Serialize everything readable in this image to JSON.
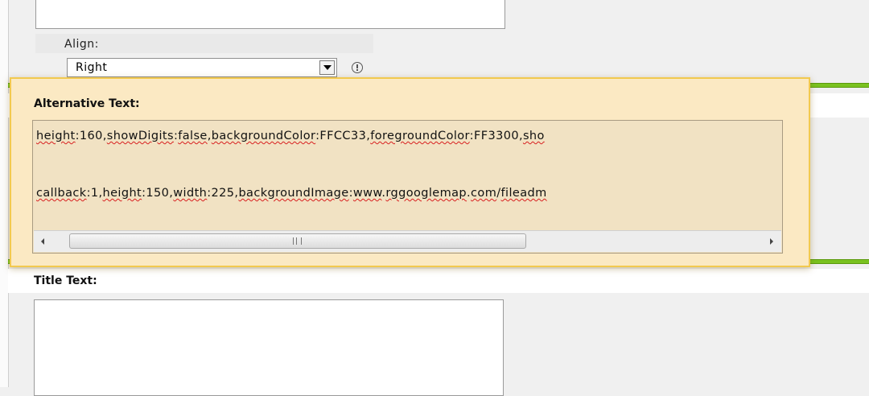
{
  "align": {
    "label": "Align:",
    "selected": "Right"
  },
  "alt_text": {
    "label": "Alternative Text:",
    "line1_parts": [
      {
        "t": "height",
        "err": true
      },
      {
        "t": ":160,",
        "err": false
      },
      {
        "t": "showDigits",
        "err": true
      },
      {
        "t": ":",
        "err": false
      },
      {
        "t": "false",
        "err": true
      },
      {
        "t": ",",
        "err": false
      },
      {
        "t": "backgroundColor",
        "err": true
      },
      {
        "t": ":FFCC33,",
        "err": false
      },
      {
        "t": "foregroundColor",
        "err": true
      },
      {
        "t": ":FF3300,",
        "err": false
      },
      {
        "t": "sho",
        "err": true
      }
    ],
    "line2_parts": [
      {
        "t": "callback",
        "err": true
      },
      {
        "t": ":1,",
        "err": false
      },
      {
        "t": "height",
        "err": true
      },
      {
        "t": ":150,",
        "err": false
      },
      {
        "t": "width",
        "err": true
      },
      {
        "t": ":225,",
        "err": false
      },
      {
        "t": "backgroundImage",
        "err": true
      },
      {
        "t": ":",
        "err": false
      },
      {
        "t": "www",
        "err": true
      },
      {
        "t": ".",
        "err": false
      },
      {
        "t": "rggooglemap",
        "err": true
      },
      {
        "t": ".",
        "err": false
      },
      {
        "t": "com",
        "err": true
      },
      {
        "t": "/",
        "err": false
      },
      {
        "t": "fileadm",
        "err": true
      }
    ]
  },
  "title_text": {
    "label": "Title Text:"
  },
  "colors": {
    "accent_green": "#7ac220",
    "panel_highlight": "#fbe9c3",
    "spell_error": "#d81f1f"
  },
  "icons": [
    "help-icon",
    "chevron-down-icon",
    "chevron-left-icon",
    "chevron-right-icon"
  ]
}
